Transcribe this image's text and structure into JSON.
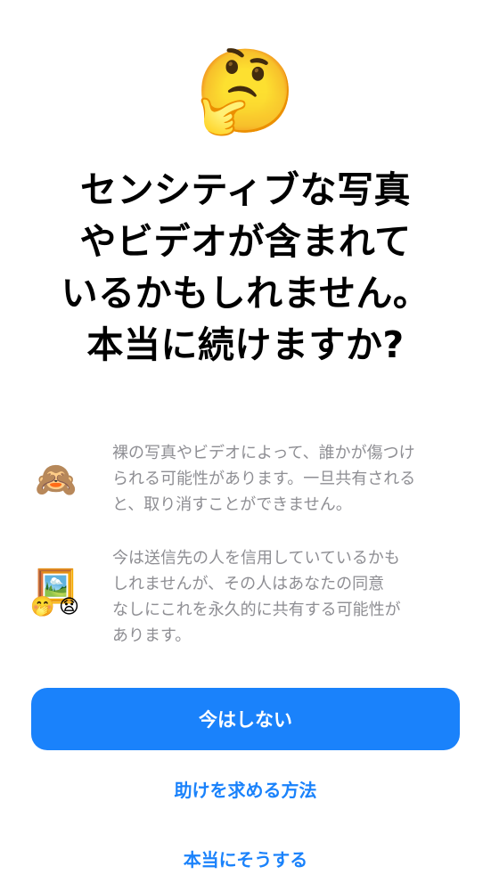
{
  "hero": {
    "emoji": "🤔",
    "icon": "thinking-face-icon"
  },
  "title": {
    "lines": [
      "センシティブな写真",
      "やビデオが含まれて",
      "いるかもしれません。",
      "本当に続けますか?"
    ]
  },
  "info": [
    {
      "icon": "see-no-evil-monkey-icon",
      "emoji": "🙈",
      "lines": [
        "裸の写真やビデオによって、誰かが傷つけ",
        "られる可能性があります。一旦共有される",
        "と、取り消すことができません。"
      ]
    },
    {
      "icon": "framed-picture-with-faces-icon",
      "emoji_frame": "🖼️",
      "emoji_face_left": "🤭",
      "emoji_face_right": "😧",
      "lines": [
        "今は送信先の人を信用していているかも",
        "しれませんが、その人はあなたの同意",
        "なしにこれを永久的に共有する可能性が",
        "あります。"
      ]
    }
  ],
  "buttons": {
    "primary": "今はしない",
    "help": "助けを求める方法",
    "confirm": "本当にそうする"
  },
  "colors": {
    "accent": "#1a82fb",
    "secondary_text": "#8e8e93",
    "background": "#ffffff"
  }
}
